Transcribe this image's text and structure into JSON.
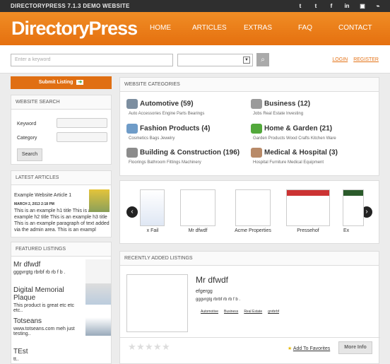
{
  "top": {
    "site": "DIRECTORYPRESS 7.1.3 DEMO WEBSITE",
    "social": [
      "t",
      "t",
      "f",
      "in",
      "▣",
      "⌁"
    ]
  },
  "header": {
    "logo": "DirectoryPress",
    "nav": [
      "HOME",
      "ARTICLES",
      "EXTRAS",
      "FAQ",
      "CONTACT"
    ]
  },
  "search": {
    "placeholder": "Enter a keyword",
    "login": "LOGIN",
    "register": "REGISTER"
  },
  "left": {
    "submit": "Submit Listing",
    "website_search": "WEBSITE SEARCH",
    "keyword": "Keyword",
    "category": "Category",
    "search_btn": "Search",
    "latest_title": "LATEST ARTICLES",
    "article": {
      "title": "Example Website Article 1",
      "date": "MARCH 2, 2013 2:18 PM",
      "body": "This is an example h1 title This is an example h2 title This is an example h3 title This is an example paragraph of text added via the admin area. This is an exampl"
    },
    "featured_title": "FEATURED LISTINGS",
    "featured": [
      {
        "name": "Mr dfwdf",
        "desc": "gggvrgtg rbrbf rb rb f b ."
      },
      {
        "name": "Digital Memorial Plaque",
        "desc": "This product is great etc etc etc.."
      },
      {
        "name": "Totseans",
        "desc": "www.totseans.com meh just testing.."
      },
      {
        "name": "TEst",
        "desc": "tt.."
      }
    ]
  },
  "categories": {
    "title": "WEBSITE CATEGORIES",
    "items": [
      {
        "name": "Automotive (59)",
        "sub": "Auto Accessories Engine Parts Bearings",
        "color": "#7c8ea0"
      },
      {
        "name": "Business (12)",
        "sub": "Jobs Real Estate Investing",
        "color": "#9a9a9a"
      },
      {
        "name": "Fashion Products (4)",
        "sub": "Cosmetics Bags Jewelry",
        "color": "#6f9cc8"
      },
      {
        "name": "Home & Garden (21)",
        "sub": "Garden Products Wood Crafts Kitchen Ware",
        "color": "#52a83b"
      },
      {
        "name": "Building & Construction (196)",
        "sub": "Floorings Bathroom Fittings Machinery",
        "color": "#8c8c8c"
      },
      {
        "name": "Medical & Hospital (3)",
        "sub": "Hospital Furniture Medical Equipment",
        "color": "#b88a68"
      }
    ]
  },
  "carousel": {
    "items": [
      "x Fail",
      "Mr dfwdf",
      "Acme Properties",
      "Pressehof",
      "Ex"
    ]
  },
  "recent": {
    "title": "RECENTLY ADDED LISTINGS",
    "name": "Mr dfwdf",
    "desc": "efgergg",
    "line": "gggvrgtg rbrbf rb rb f b .",
    "tags": [
      "Automotive",
      "Business",
      "Real Estate",
      "gnrbrbf"
    ],
    "add": "Add To Favorites",
    "more": "More Info"
  }
}
